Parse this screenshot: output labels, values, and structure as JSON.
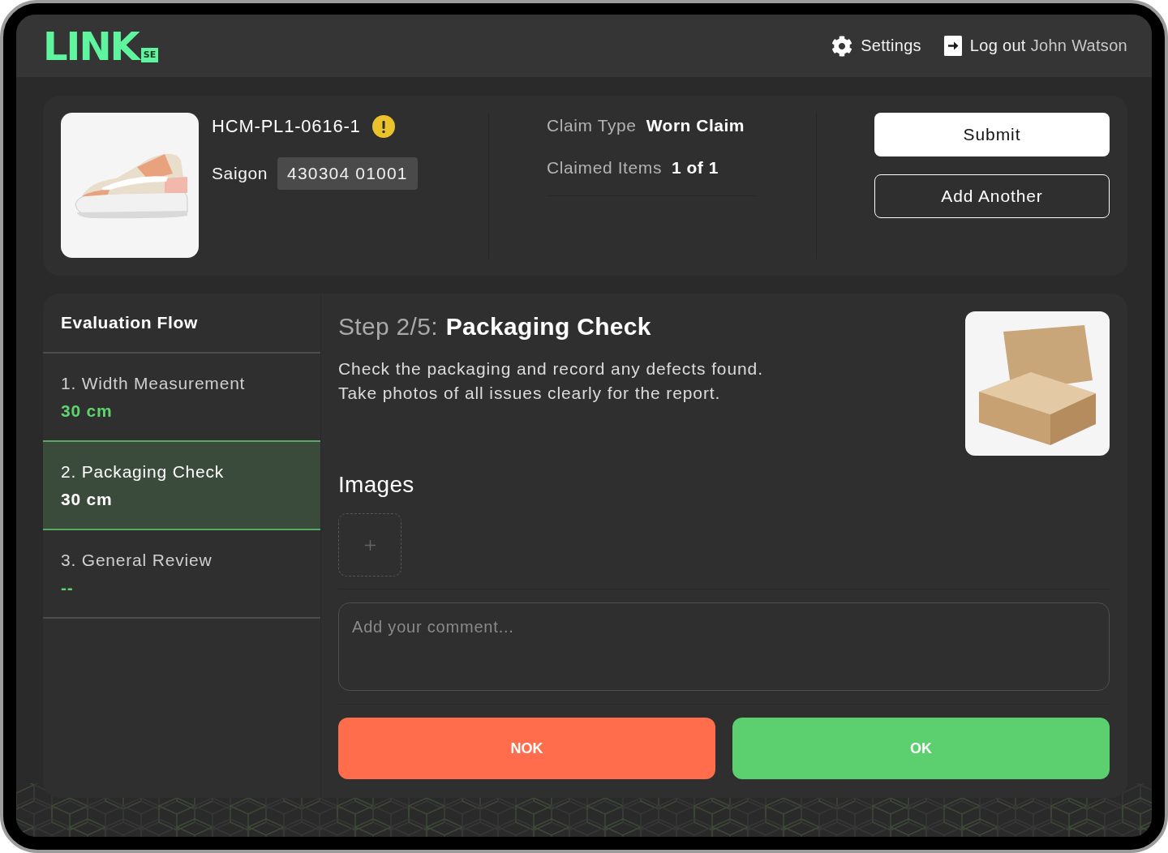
{
  "header": {
    "logo": {
      "wordmark": "LINK",
      "badge": "SE"
    },
    "settings": "Settings",
    "logout": {
      "label": "Log out",
      "user": "John Watson"
    }
  },
  "claim": {
    "id": "HCM-PL1-0616-1",
    "warning": true,
    "location": "Saigon",
    "code": "430304 01001",
    "fields": [
      {
        "label": "Claim Type",
        "value": "Worn Claim"
      },
      {
        "label": "Claimed Items",
        "value": "1 of 1"
      }
    ],
    "buttons": [
      {
        "label": "Submit",
        "kind": "primary"
      },
      {
        "label": "Add Another",
        "kind": "outline"
      }
    ]
  },
  "flow": {
    "title": "Evaluation Flow",
    "steps": [
      {
        "label": "1. Width Measurement",
        "value": "30 cm",
        "selected": false
      },
      {
        "label": "2. Packaging Check",
        "value": "30 cm",
        "selected": true
      },
      {
        "label": "3. General Review",
        "value": "--",
        "selected": false
      }
    ]
  },
  "step": {
    "counter": "Step 2/5:",
    "title": "Packaging Check",
    "description": [
      "Check the packaging and record any defects found.",
      "Take photos of all issues clearly for the report."
    ],
    "images_title": "Images",
    "comment_placeholder": "Add your comment...",
    "actions": [
      {
        "label": "NOK",
        "kind": "fail"
      },
      {
        "label": "OK",
        "kind": "pass"
      }
    ]
  }
}
